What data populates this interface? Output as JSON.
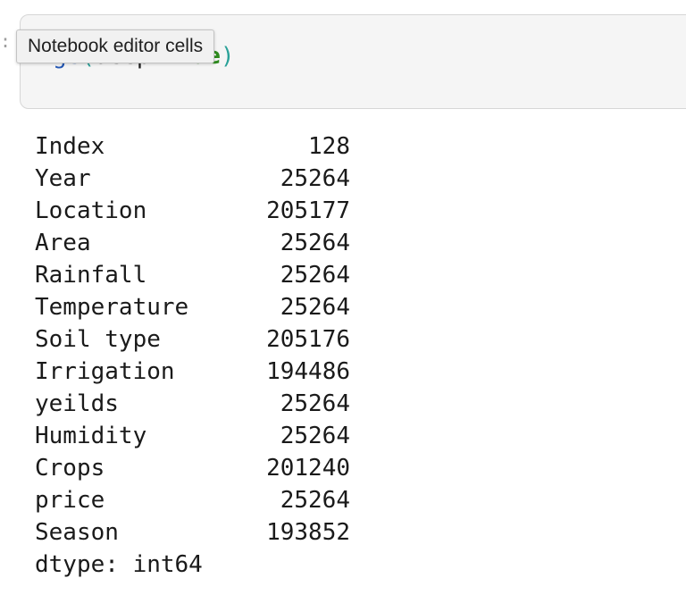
{
  "prompt_marker": ":",
  "tooltip": {
    "text": "Notebook editor cells"
  },
  "code_cell": {
    "method_fragment": "ge",
    "open_paren": "(",
    "arg_name": "deep",
    "equals": "=",
    "arg_value": "True",
    "close_paren": ")"
  },
  "output": {
    "rows": [
      {
        "label": "Index",
        "value": "128"
      },
      {
        "label": "Year",
        "value": "25264"
      },
      {
        "label": "Location",
        "value": "205177"
      },
      {
        "label": "Area",
        "value": "25264"
      },
      {
        "label": "Rainfall",
        "value": "25264"
      },
      {
        "label": "Temperature",
        "value": "25264"
      },
      {
        "label": "Soil type",
        "value": "205176"
      },
      {
        "label": "Irrigation",
        "value": "194486"
      },
      {
        "label": "yeilds",
        "value": "25264"
      },
      {
        "label": "Humidity",
        "value": "25264"
      },
      {
        "label": "Crops",
        "value": "201240"
      },
      {
        "label": "price",
        "value": "25264"
      },
      {
        "label": "Season",
        "value": "193852"
      }
    ],
    "dtype_line": "dtype: int64"
  }
}
